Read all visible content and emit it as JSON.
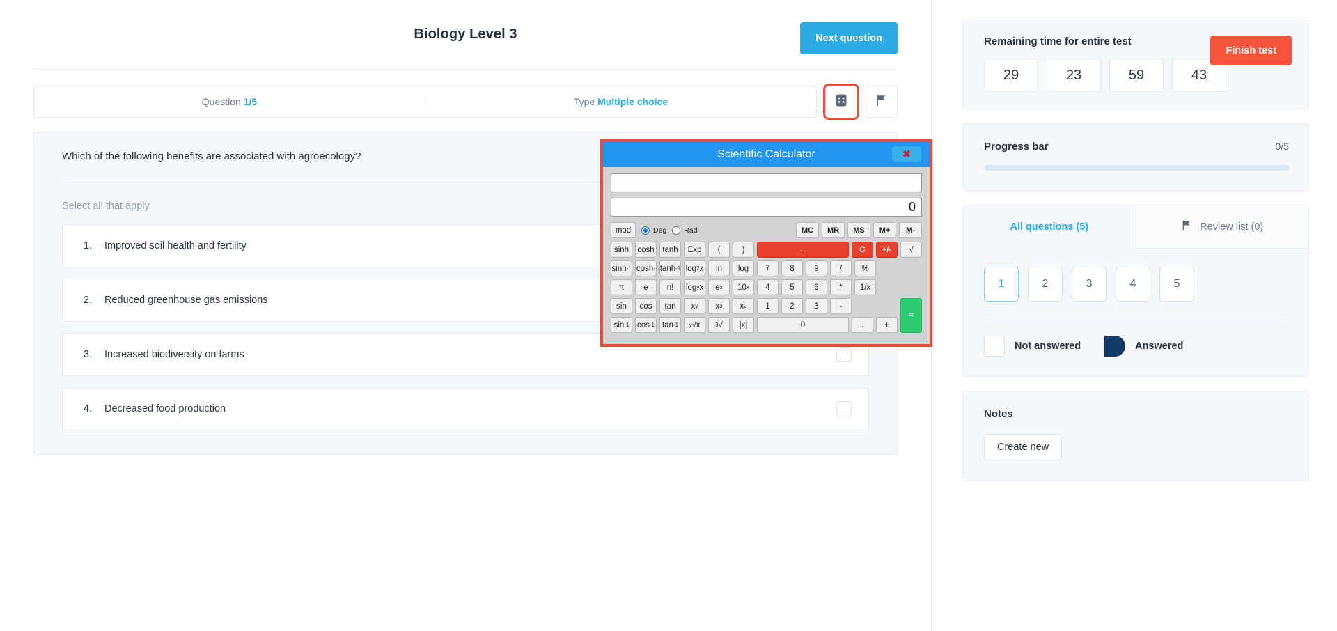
{
  "header": {
    "test_title": "Biology Level 3",
    "next_question_label": "Next question"
  },
  "meta": {
    "question_label": "Question",
    "question_value": "1/5",
    "type_label": "Type",
    "type_value": "Multiple choice",
    "calculator_icon": "calculator-grid-icon",
    "flag_icon": "flag-icon"
  },
  "question": {
    "text": "Which of the following benefits are associated with agroecology?",
    "hint": "Select all that apply",
    "choices": [
      {
        "num": "1.",
        "label": "Improved soil health and fertility"
      },
      {
        "num": "2.",
        "label": "Reduced greenhouse gas emissions"
      },
      {
        "num": "3.",
        "label": "Increased biodiversity on farms"
      },
      {
        "num": "4.",
        "label": "Decreased food production"
      }
    ]
  },
  "sidebar": {
    "timer": {
      "title": "Remaining time for entire test",
      "finish_label": "Finish test",
      "values": [
        "29",
        "23",
        "59",
        "43"
      ]
    },
    "progress": {
      "label": "Progress bar",
      "count": "0/5",
      "percent": 0
    },
    "qnav": {
      "tab_all": "All questions (5)",
      "tab_review": "Review list (0)",
      "review_icon": "flag-icon",
      "numbers": [
        "1",
        "2",
        "3",
        "4",
        "5"
      ],
      "current": "1",
      "legend_not_answered": "Not answered",
      "legend_answered": "Answered"
    },
    "notes": {
      "title": "Notes",
      "create_label": "Create new"
    }
  },
  "calculator": {
    "title": "Scientific Calculator",
    "close_icon": "close-x-icon",
    "expression": "",
    "result": "0",
    "mod_label": "mod",
    "deg_label": "Deg",
    "rad_label": "Rad",
    "angle_mode": "Deg",
    "memory": [
      "MC",
      "MR",
      "MS",
      "M+",
      "M-"
    ],
    "rows": [
      [
        "sinh",
        "cosh",
        "tanh",
        "Exp",
        "(",
        ")",
        "←",
        "C",
        "+/-",
        "√"
      ],
      [
        "sinh-1",
        "cosh-",
        "tanh-1",
        "log2x",
        "ln",
        "log",
        "7",
        "8",
        "9",
        "/",
        "%"
      ],
      [
        "π",
        "e",
        "n!",
        "logyx",
        "e^x",
        "10^x",
        "4",
        "5",
        "6",
        "*",
        "1/x"
      ],
      [
        "sin",
        "cos",
        "tan",
        "x^y",
        "x^3",
        "x^2",
        "1",
        "2",
        "3",
        "-",
        "="
      ],
      [
        "sin-1",
        "cos-1",
        "tan-1",
        "ⁿ√x",
        "³√",
        "|x|",
        "0",
        ".",
        "+"
      ]
    ],
    "colors": {
      "title_bar": "#2196f3",
      "accent_red": "#e8422e",
      "accent_green": "#2ecc71",
      "frame": "#ea4b3b"
    }
  },
  "theme": {
    "accent_blue": "#2cabe3",
    "danger_red": "#f9553c",
    "panel_bg": "#f5f8fd",
    "answered_navy": "#133b68"
  }
}
